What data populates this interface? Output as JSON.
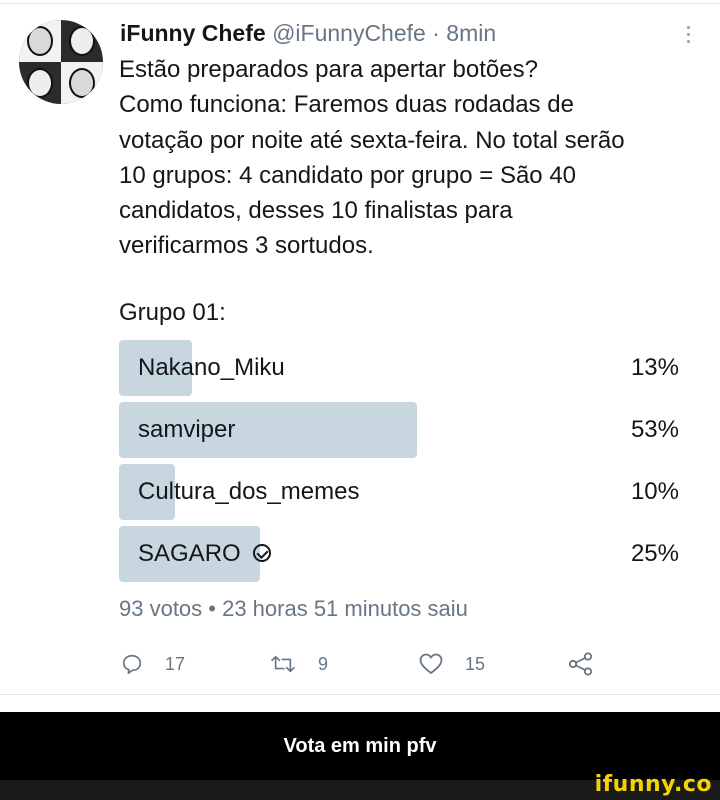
{
  "tweet": {
    "author_name": "iFunny Chefe",
    "author_handle": "@iFunnyChefe",
    "separator": "·",
    "time": "8min",
    "body_lines": [
      "Estão preparados para apertar botões?",
      "Como funciona: Faremos duas rodadas de",
      "votação por noite até sexta-feira. No total serão",
      "10 grupos: 4 candidato por grupo = São 40",
      "candidatos, desses 10 finalistas para",
      "verificarmos 3 sortudos."
    ]
  },
  "poll": {
    "title": "Grupo 01:",
    "options": [
      {
        "label": "Nakano_Miku",
        "percent_text": "13%",
        "percent": 13,
        "selected": false
      },
      {
        "label": "samviper",
        "percent_text": "53%",
        "percent": 53,
        "selected": false
      },
      {
        "label": "Cultura_dos_memes",
        "percent_text": "10%",
        "percent": 10,
        "selected": false
      },
      {
        "label": "SAGARO",
        "percent_text": "25%",
        "percent": 25,
        "selected": true
      }
    ],
    "meta": "93 votos • 23 horas 51 minutos saiu"
  },
  "actions": {
    "replies": "17",
    "retweets": "9",
    "likes": "15"
  },
  "caption": "Vota em min pfv",
  "watermark": "ifunny.co",
  "colors": {
    "poll_bar": "#c8d6e0",
    "secondary_text": "#687684",
    "watermark": "#f5d300"
  }
}
